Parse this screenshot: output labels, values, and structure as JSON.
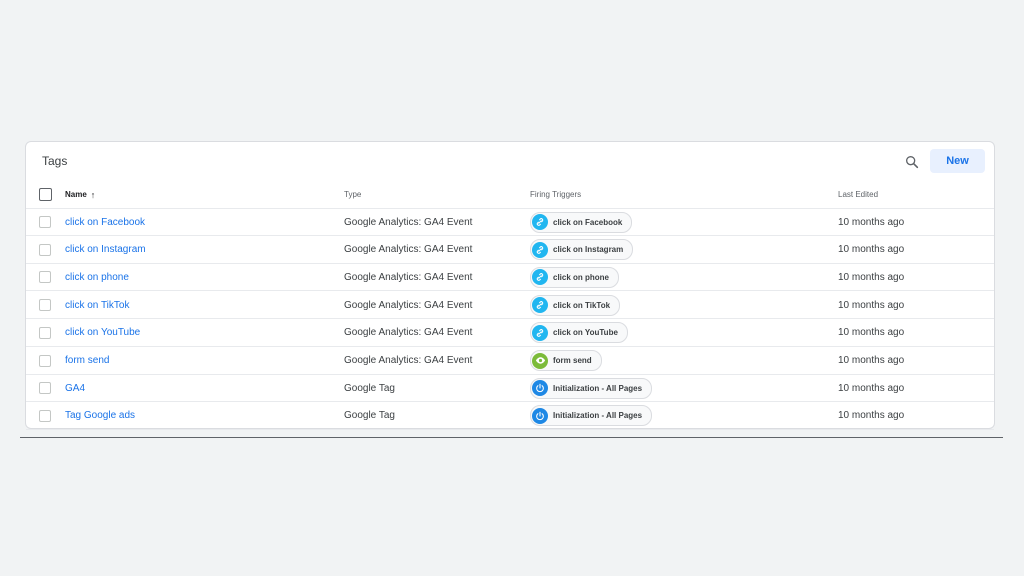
{
  "panel": {
    "title": "Tags",
    "new_label": "New"
  },
  "colors": {
    "link": "#1a73e8",
    "click_trigger": "#21b6f0",
    "form_trigger": "#7cbb3a",
    "init_trigger": "#1e88e5"
  },
  "columns": {
    "name": "Name",
    "type": "Type",
    "firing_triggers": "Firing Triggers",
    "last_edited": "Last Edited"
  },
  "rows": [
    {
      "name": "click on Facebook",
      "type": "Google Analytics: GA4 Event",
      "trigger": "click on Facebook",
      "trigger_icon": "link-icon",
      "edited": "10 months ago"
    },
    {
      "name": "click on Instagram",
      "type": "Google Analytics: GA4 Event",
      "trigger": "click on Instagram",
      "trigger_icon": "link-icon",
      "edited": "10 months ago"
    },
    {
      "name": "click on phone",
      "type": "Google Analytics: GA4 Event",
      "trigger": "click on phone",
      "trigger_icon": "link-icon",
      "edited": "10 months ago"
    },
    {
      "name": "click on TikTok",
      "type": "Google Analytics: GA4 Event",
      "trigger": "click on TikTok",
      "trigger_icon": "link-icon",
      "edited": "10 months ago"
    },
    {
      "name": "click on YouTube",
      "type": "Google Analytics: GA4 Event",
      "trigger": "click on YouTube",
      "trigger_icon": "link-icon",
      "edited": "10 months ago"
    },
    {
      "name": "form send",
      "type": "Google Analytics: GA4 Event",
      "trigger": "form send",
      "trigger_icon": "eye-icon",
      "edited": "10 months ago"
    },
    {
      "name": "GA4",
      "type": "Google Tag",
      "trigger": "Initialization - All Pages",
      "trigger_icon": "power-icon",
      "edited": "10 months ago"
    },
    {
      "name": "Tag Google ads",
      "type": "Google Tag",
      "trigger": "Initialization - All Pages",
      "trigger_icon": "power-icon",
      "edited": "10 months ago"
    }
  ]
}
